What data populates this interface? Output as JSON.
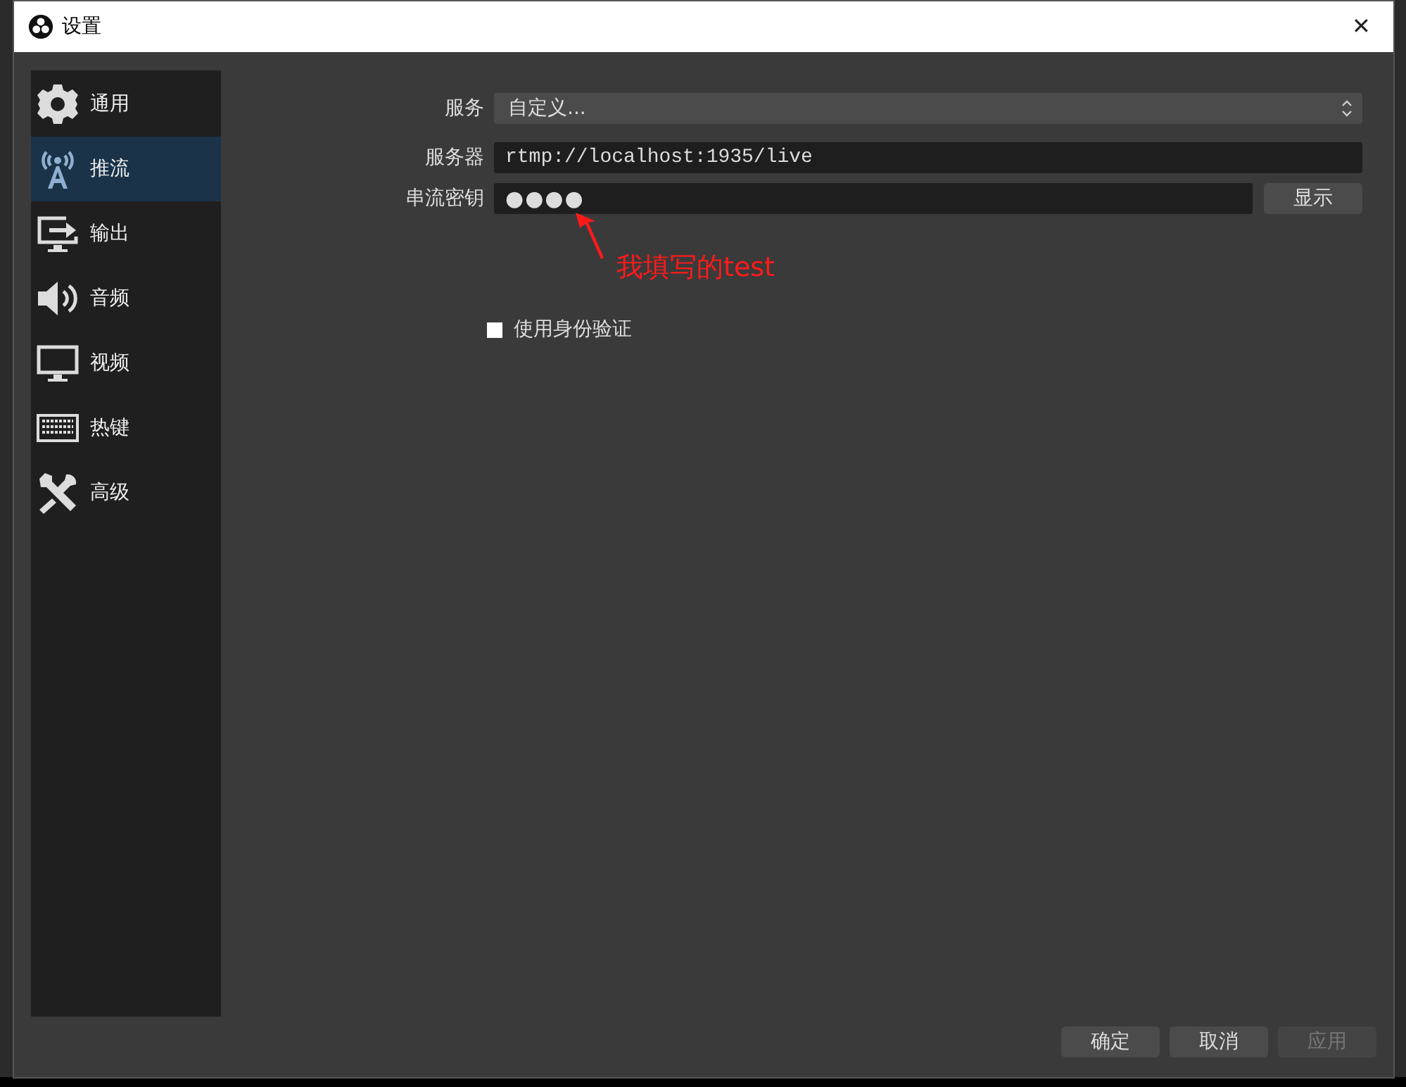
{
  "window": {
    "title": "设置",
    "close": "✕"
  },
  "sidebar": {
    "items": [
      {
        "label": "通用",
        "kind": "gear",
        "selected": false
      },
      {
        "label": "推流",
        "kind": "antenna",
        "selected": true
      },
      {
        "label": "输出",
        "kind": "output",
        "selected": false
      },
      {
        "label": "音频",
        "kind": "speaker",
        "selected": false
      },
      {
        "label": "视频",
        "kind": "monitor",
        "selected": false
      },
      {
        "label": "热键",
        "kind": "keyboard",
        "selected": false
      },
      {
        "label": "高级",
        "kind": "tools",
        "selected": false
      }
    ]
  },
  "form": {
    "service": {
      "label": "服务",
      "value": "自定义..."
    },
    "server": {
      "label": "服务器",
      "value": "rtmp://localhost:1935/live"
    },
    "stream_key": {
      "label": "串流密钥",
      "value": "●●●●",
      "show_button": "显示"
    },
    "auth": {
      "label": "使用身份验证",
      "checked": false
    }
  },
  "annotation": {
    "text": "我填写的test"
  },
  "buttons": [
    {
      "label": "确定",
      "disabled": false
    },
    {
      "label": "取消",
      "disabled": false
    },
    {
      "label": "应用",
      "disabled": true
    }
  ]
}
